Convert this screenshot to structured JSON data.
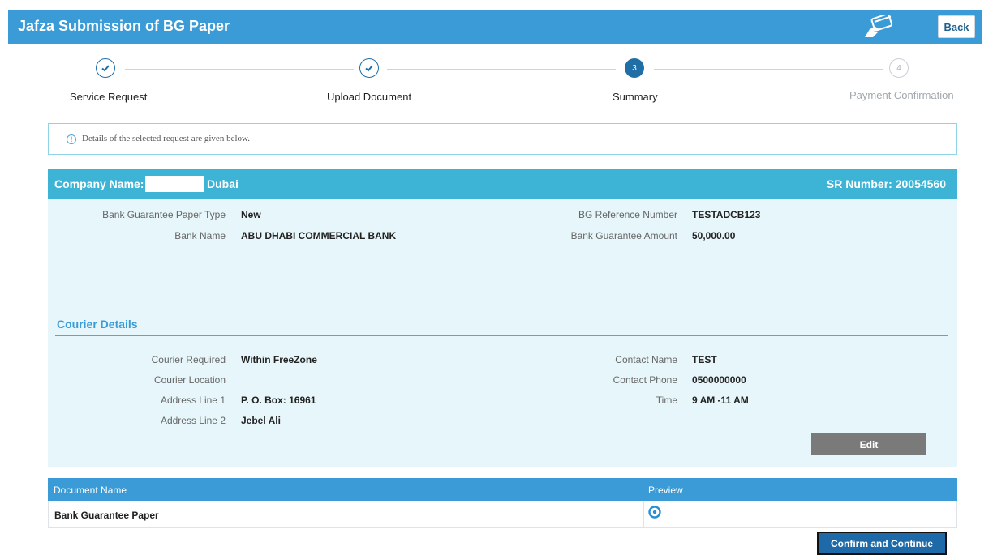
{
  "header": {
    "title": "Jafza Submission of BG Paper",
    "back_label": "Back"
  },
  "steps": [
    {
      "number": "1",
      "label": "Service Request",
      "state": "done"
    },
    {
      "number": "2",
      "label": "Upload Document",
      "state": "done"
    },
    {
      "number": "3",
      "label": "Summary",
      "state": "current"
    },
    {
      "number": "4",
      "label": "Payment Confirmation",
      "state": "future"
    }
  ],
  "info": {
    "message": "Details of the selected request are given below."
  },
  "company": {
    "label": "Company Name:",
    "name_suffix": "Dubai",
    "sr_number": "SR Number: 20054560"
  },
  "bank_details": {
    "paper_type_label": "Bank Guarantee Paper Type",
    "paper_type_value": "New",
    "bank_name_label": "Bank Name",
    "bank_name_value": "ABU DHABI COMMERCIAL BANK",
    "ref_label": "BG Reference Number",
    "ref_value": "TESTADCB123",
    "amount_label": "Bank Guarantee Amount",
    "amount_value": "50,000.00"
  },
  "courier": {
    "title": "Courier Details",
    "required_label": "Courier Required",
    "required_value": "Within FreeZone",
    "location_label": "Courier Location",
    "location_value": "",
    "address1_label": "Address Line 1",
    "address1_value": "P. O. Box: 16961",
    "address2_label": "Address Line 2",
    "address2_value": "Jebel Ali",
    "contact_name_label": "Contact Name",
    "contact_name_value": "TEST",
    "contact_phone_label": "Contact Phone",
    "contact_phone_value": "0500000000",
    "time_label": "Time",
    "time_value": "9 AM -11 AM",
    "edit_label": "Edit"
  },
  "documents": {
    "headers": [
      "Document Name",
      "Preview"
    ],
    "rows": [
      {
        "name": "Bank Guarantee Paper",
        "preview_icon": "eye-icon"
      }
    ]
  },
  "actions": {
    "confirm_label": "Confirm and Continue"
  },
  "colors": {
    "header_blue": "#3a9bd6",
    "company_bar": "#3db4d6",
    "panel_bg": "#e6f6fa",
    "step_blue": "#1f6ea5",
    "edit_grey": "#7a7a7a",
    "confirm_blue": "#1e6aa8"
  }
}
